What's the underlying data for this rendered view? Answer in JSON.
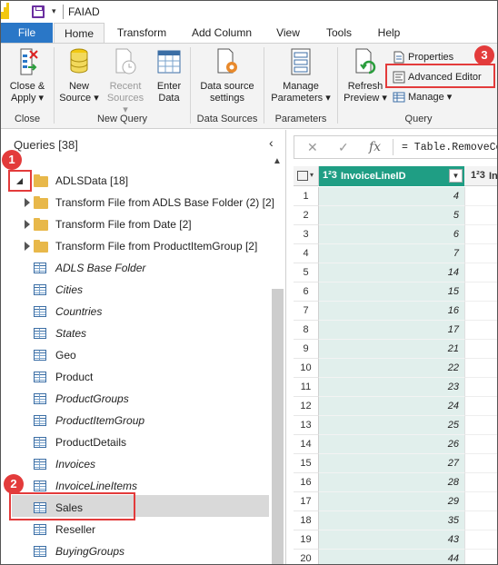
{
  "window": {
    "title": "FAIAD",
    "qat_dropdown": "▾"
  },
  "tabs": [
    "File",
    "Home",
    "Transform",
    "Add Column",
    "View",
    "Tools",
    "Help"
  ],
  "ribbon": {
    "close_group": {
      "label": "Close",
      "close_apply": "Close &",
      "close_apply2": "Apply ▾"
    },
    "new_query_group": {
      "label": "New Query",
      "new_source": "New",
      "new_source2": "Source ▾",
      "recent_sources": "Recent",
      "recent_sources2": "Sources ▾",
      "enter_data": "Enter",
      "enter_data2": "Data"
    },
    "data_sources_group": {
      "label": "Data Sources",
      "settings": "Data source",
      "settings2": "settings"
    },
    "parameters_group": {
      "label": "Parameters",
      "manage": "Manage",
      "manage2": "Parameters ▾"
    },
    "query_group": {
      "label": "Query",
      "refresh": "Refresh",
      "refresh2": "Preview ▾",
      "properties": "Properties",
      "advanced_editor": "Advanced Editor",
      "manage": "Manage ▾"
    }
  },
  "queries": {
    "header": "Queries [38]",
    "collapse_glyph": "‹",
    "group_name": "ADLSData [18]",
    "folders": [
      "Transform File from ADLS Base Folder (2) [2]",
      "Transform File from Date [2]",
      "Transform File from ProductItemGroup [2]"
    ],
    "items": [
      {
        "name": "ADLS Base Folder",
        "italic": true
      },
      {
        "name": "Cities",
        "italic": true
      },
      {
        "name": "Countries",
        "italic": true
      },
      {
        "name": "States",
        "italic": true
      },
      {
        "name": "Geo",
        "italic": false
      },
      {
        "name": "Product",
        "italic": false
      },
      {
        "name": "ProductGroups",
        "italic": true
      },
      {
        "name": "ProductItemGroup",
        "italic": true
      },
      {
        "name": "ProductDetails",
        "italic": false
      },
      {
        "name": "Invoices",
        "italic": true
      },
      {
        "name": "InvoiceLineItems",
        "italic": true
      },
      {
        "name": "Sales",
        "italic": false
      },
      {
        "name": "Reseller",
        "italic": false
      },
      {
        "name": "BuyingGroups",
        "italic": true
      }
    ],
    "selected": "Sales"
  },
  "formula_bar": {
    "cancel_glyph": "✕",
    "commit_glyph": "✓",
    "fx": "fx",
    "text": "= Table.RemoveCo"
  },
  "grid": {
    "type_glyph": "1²3",
    "column1": "InvoiceLineID",
    "column2": "In",
    "rows": [
      {
        "n": "1",
        "v": "4"
      },
      {
        "n": "2",
        "v": "5"
      },
      {
        "n": "3",
        "v": "6"
      },
      {
        "n": "4",
        "v": "7"
      },
      {
        "n": "5",
        "v": "14"
      },
      {
        "n": "6",
        "v": "15"
      },
      {
        "n": "7",
        "v": "16"
      },
      {
        "n": "8",
        "v": "17"
      },
      {
        "n": "9",
        "v": "21"
      },
      {
        "n": "10",
        "v": "22"
      },
      {
        "n": "11",
        "v": "23"
      },
      {
        "n": "12",
        "v": "24"
      },
      {
        "n": "13",
        "v": "25"
      },
      {
        "n": "14",
        "v": "26"
      },
      {
        "n": "15",
        "v": "27"
      },
      {
        "n": "16",
        "v": "28"
      },
      {
        "n": "17",
        "v": "29"
      },
      {
        "n": "18",
        "v": "35"
      },
      {
        "n": "19",
        "v": "43"
      },
      {
        "n": "20",
        "v": "44"
      }
    ]
  },
  "annotations": {
    "badge1": "1",
    "badge2": "2",
    "badge3": "3",
    "color": "#e33b3b"
  },
  "colors": {
    "file_tab": "#2a77c7",
    "column_header": "#1f9e84",
    "folder": "#e8b84a"
  }
}
